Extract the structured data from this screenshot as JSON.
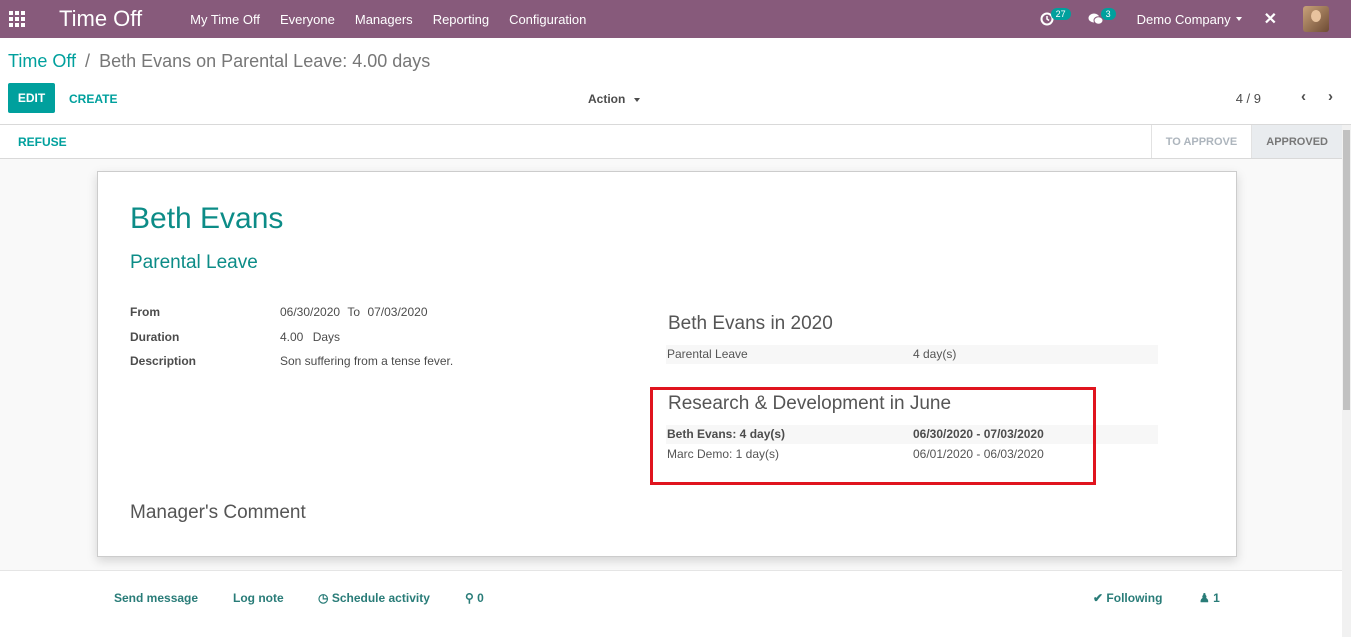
{
  "navbar": {
    "app_title": "Time Off",
    "menu": [
      "My Time Off",
      "Everyone",
      "Managers",
      "Reporting",
      "Configuration"
    ],
    "activity_count": "27",
    "message_count": "3",
    "company": "Demo Company"
  },
  "breadcrumb": {
    "parent": "Time Off",
    "separator": "/",
    "current": "Beth Evans on Parental Leave: 4.00 days"
  },
  "toolbar": {
    "edit_label": "EDIT",
    "create_label": "CREATE",
    "action_label": "Action",
    "pager": "4 / 9"
  },
  "statusbar": {
    "refuse_label": "REFUSE",
    "stages": [
      {
        "label": "TO APPROVE",
        "active": false
      },
      {
        "label": "APPROVED",
        "active": true
      }
    ]
  },
  "form": {
    "employee": "Beth Evans",
    "leave_type": "Parental Leave",
    "from_label": "From",
    "from_date": "06/30/2020",
    "to_word": "To",
    "to_date": "07/03/2020",
    "duration_label": "Duration",
    "duration_value": "4.00",
    "duration_unit": "Days",
    "description_label": "Description",
    "description_value": "Son suffering from a tense fever.",
    "manager_comment_title": "Manager's Comment"
  },
  "summary_year": {
    "title": "Beth Evans in 2020",
    "rows": [
      {
        "label": "Parental Leave",
        "value": "4 day(s)"
      }
    ]
  },
  "summary_department": {
    "title": "Research & Development in June",
    "rows": [
      {
        "label": "Beth Evans: 4 day(s)",
        "value": "06/30/2020 - 07/03/2020",
        "bold": true
      },
      {
        "label": "Marc Demo: 1 day(s)",
        "value": "06/01/2020 - 06/03/2020",
        "bold": false
      }
    ]
  },
  "chatter": {
    "send_message": "Send message",
    "log_note": "Log note",
    "schedule_activity": "Schedule activity",
    "attachments": "0",
    "following": "Following",
    "followers": "1"
  },
  "colors": {
    "navbar": "#875a7b",
    "accent": "#00a09d",
    "highlight": "#e0141e"
  }
}
